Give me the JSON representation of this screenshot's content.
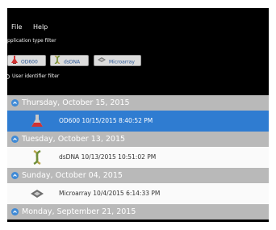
{
  "menu": {
    "file": "File",
    "help": "Help"
  },
  "filters": {
    "app_type_label": "pplication type filter",
    "user_id_label": "User identifier filter",
    "buttons": [
      {
        "label": "OD600",
        "icon": "flask-icon"
      },
      {
        "label": "dsDNA",
        "icon": "dna-icon"
      },
      {
        "label": "Microarray",
        "icon": "microarray-icon"
      }
    ]
  },
  "groups": [
    {
      "title": "Thursday, October 15, 2015",
      "item": {
        "text": "OD600 10/15/2015 8:40:52 PM",
        "icon": "flask-icon",
        "selected": true
      }
    },
    {
      "title": "Tuesday, October 13, 2015",
      "item": {
        "text": "dsDNA 10/13/2015 10:51:02 PM",
        "icon": "dna-icon",
        "selected": false
      }
    },
    {
      "title": "Sunday, October 04, 2015",
      "item": {
        "text": "Microarray 10/4/2015 6:14:33 PM",
        "icon": "microarray-icon",
        "selected": false
      }
    },
    {
      "title": "Monday, September 21, 2015"
    }
  ],
  "colors": {
    "background": "#000000",
    "group_header": "#b9b9b9",
    "selected_row": "#2f7cd1",
    "accent": "#3f8ad6"
  }
}
